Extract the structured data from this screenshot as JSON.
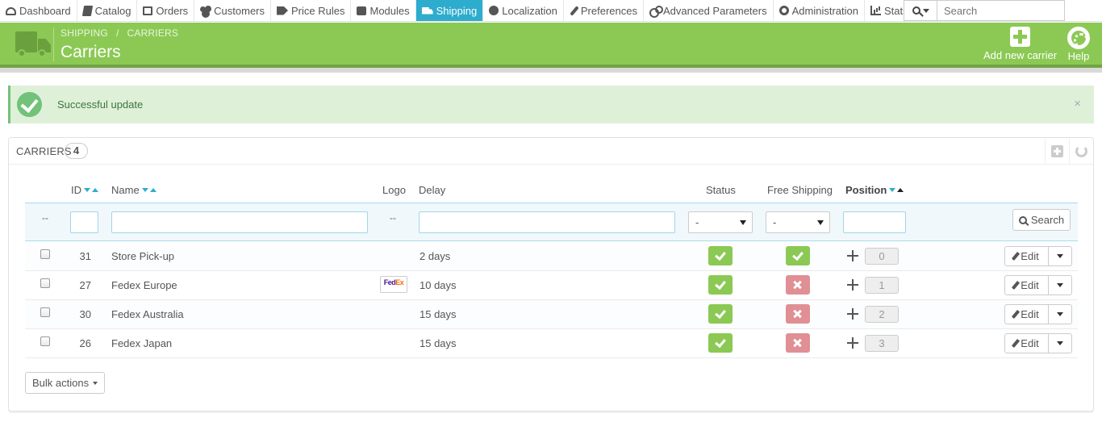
{
  "nav": {
    "items": [
      {
        "label": "Dashboard",
        "icon": "dashboard-icon"
      },
      {
        "label": "Catalog",
        "icon": "book-icon"
      },
      {
        "label": "Orders",
        "icon": "list-icon"
      },
      {
        "label": "Customers",
        "icon": "users-icon"
      },
      {
        "label": "Price Rules",
        "icon": "tags-icon"
      },
      {
        "label": "Modules",
        "icon": "puzzle-icon"
      },
      {
        "label": "Shipping",
        "icon": "truck-icon",
        "active": true
      },
      {
        "label": "Localization",
        "icon": "globe-icon"
      },
      {
        "label": "Preferences",
        "icon": "wrench-icon"
      },
      {
        "label": "Advanced Parameters",
        "icon": "cogs-icon"
      },
      {
        "label": "Administration",
        "icon": "cog-icon"
      },
      {
        "label": "Stats",
        "icon": "bar-chart-icon"
      }
    ],
    "search_placeholder": "Search"
  },
  "header": {
    "breadcrumb": [
      "SHIPPING",
      "CARRIERS"
    ],
    "title": "Carriers",
    "add_label": "Add new carrier",
    "help_label": "Help",
    "color": "#8bc954"
  },
  "alert": {
    "text": "Successful update",
    "close": "×"
  },
  "panel": {
    "title": "Carriers",
    "count": "4",
    "columns": {
      "id": "ID",
      "name": "Name",
      "logo": "Logo",
      "delay": "Delay",
      "status": "Status",
      "free_shipping": "Free Shipping",
      "position": "Position"
    },
    "filters": {
      "bulk_dash": "--",
      "logo_dash": "--",
      "status_select": "-",
      "free_select": "-",
      "search_label": "Search"
    },
    "rows": [
      {
        "id": "31",
        "name": "Store Pick-up",
        "logo": "",
        "delay": "2 days",
        "status": true,
        "free": true,
        "position": "0"
      },
      {
        "id": "27",
        "name": "Fedex Europe",
        "logo": "FedEx",
        "delay": "10 days",
        "status": true,
        "free": false,
        "position": "1"
      },
      {
        "id": "30",
        "name": "Fedex Australia",
        "logo": "",
        "delay": "15 days",
        "status": true,
        "free": false,
        "position": "2"
      },
      {
        "id": "26",
        "name": "Fedex Japan",
        "logo": "",
        "delay": "15 days",
        "status": true,
        "free": false,
        "position": "3"
      }
    ],
    "edit_label": "Edit",
    "bulk_label": "Bulk actions",
    "logo_text": {
      "fe": "Fed",
      "ex": "Ex"
    }
  }
}
